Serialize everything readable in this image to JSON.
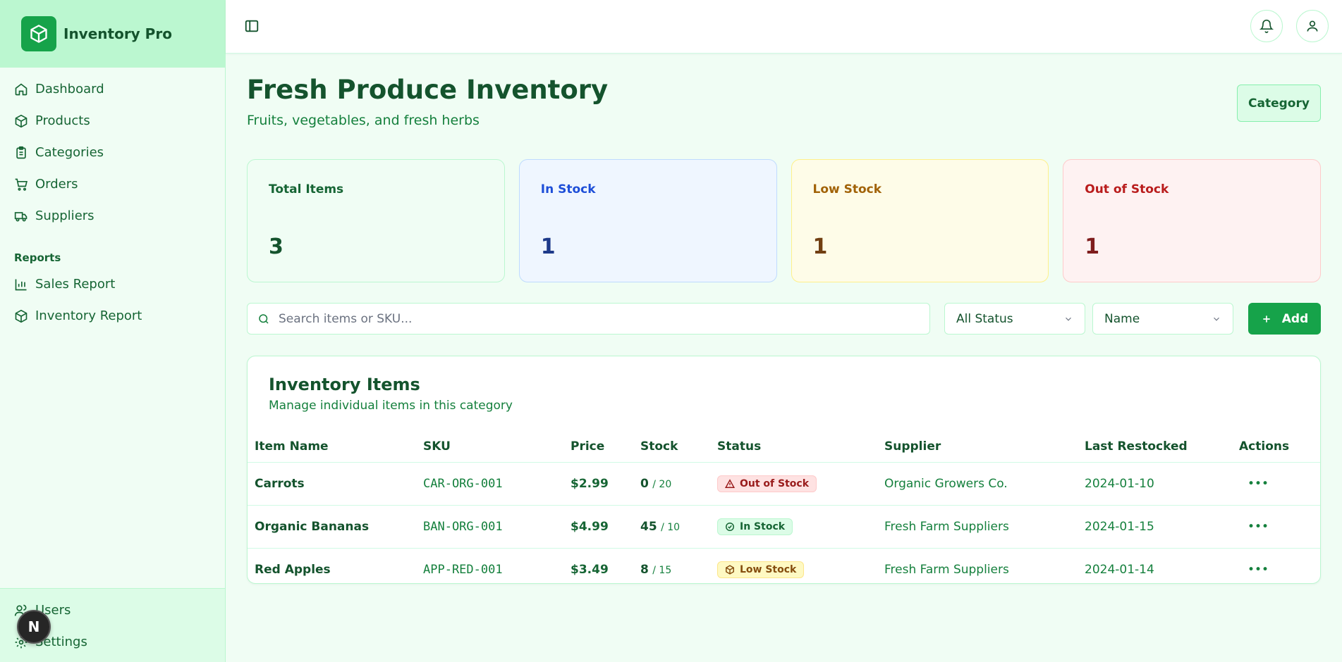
{
  "app": {
    "name": "Inventory Pro"
  },
  "sidebar": {
    "items": [
      {
        "label": "Dashboard",
        "icon": "home-icon"
      },
      {
        "label": "Products",
        "icon": "package-icon"
      },
      {
        "label": "Categories",
        "icon": "clipboard-icon"
      },
      {
        "label": "Orders",
        "icon": "cart-icon"
      },
      {
        "label": "Suppliers",
        "icon": "truck-icon"
      }
    ],
    "reports_label": "Reports",
    "reports": [
      {
        "label": "Sales Report",
        "icon": "bar-chart-icon"
      },
      {
        "label": "Inventory Report",
        "icon": "package-icon"
      }
    ],
    "footer": [
      {
        "label": "Users",
        "icon": "users-icon"
      },
      {
        "label": "Settings",
        "icon": "gear-icon"
      }
    ],
    "avatar_initial": "N"
  },
  "header": {
    "title": "Fresh Produce Inventory",
    "subtitle": "Fruits, vegetables, and fresh herbs",
    "category_button": "Category"
  },
  "stats": [
    {
      "label": "Total Items",
      "value": "3"
    },
    {
      "label": "In Stock",
      "value": "1"
    },
    {
      "label": "Low Stock",
      "value": "1"
    },
    {
      "label": "Out of Stock",
      "value": "1"
    }
  ],
  "toolbar": {
    "search_placeholder": "Search items or SKU...",
    "status_filter": "All Status",
    "sort": "Name",
    "add_label": "Add"
  },
  "table": {
    "title": "Inventory Items",
    "subtitle": "Manage individual items in this category",
    "columns": [
      "Item Name",
      "SKU",
      "Price",
      "Stock",
      "Status",
      "Supplier",
      "Last Restocked",
      "Actions"
    ],
    "rows": [
      {
        "name": "Carrots",
        "sku": "CAR-ORG-001",
        "price": "$2.99",
        "stock": "0",
        "min": "/ 20",
        "status": "Out of Stock",
        "supplier": "Organic Growers Co.",
        "restocked": "2024-01-10"
      },
      {
        "name": "Organic Bananas",
        "sku": "BAN-ORG-001",
        "price": "$4.99",
        "stock": "45",
        "min": "/ 10",
        "status": "In Stock",
        "supplier": "Fresh Farm Suppliers",
        "restocked": "2024-01-15"
      },
      {
        "name": "Red Apples",
        "sku": "APP-RED-001",
        "price": "$3.49",
        "stock": "8",
        "min": "/ 15",
        "status": "Low Stock",
        "supplier": "Fresh Farm Suppliers",
        "restocked": "2024-01-14"
      }
    ],
    "actions_glyph": "•••"
  },
  "colors": {
    "primary": "#16a34a",
    "sidebar_header": "#bbf7d0",
    "background": "#f0fdf4"
  }
}
